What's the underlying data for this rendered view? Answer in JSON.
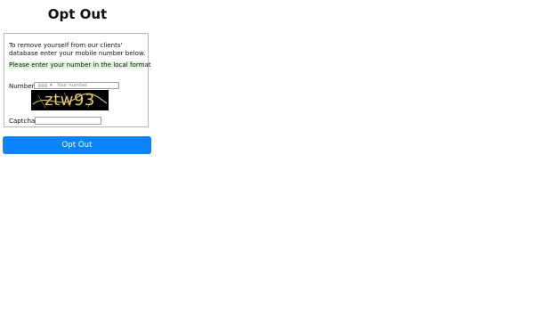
{
  "page": {
    "title": "Opt Out"
  },
  "form": {
    "intro_text": "To remove yourself from our clients' database enter your mobile number below.",
    "notice_text": "Please enter your number in the local format",
    "number_label": "Number",
    "number_placeholder": "Your number",
    "number_value": "",
    "country_selector_icon": "flag-placeholder-icon",
    "captcha_label": "Captcha",
    "captcha_image_text": "ztw93",
    "captcha_value": ""
  },
  "actions": {
    "submit_label": "Opt Out",
    "submit_color": "#0b83fd"
  },
  "colors": {
    "notice_background": "#e2f3df",
    "captcha_background": "#000000",
    "captcha_text": "#f1d77c"
  }
}
